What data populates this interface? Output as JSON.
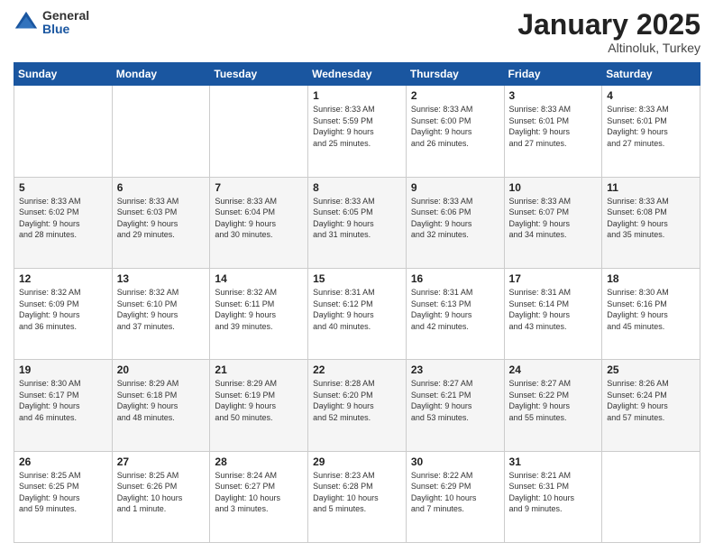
{
  "header": {
    "logo_general": "General",
    "logo_blue": "Blue",
    "month": "January 2025",
    "location": "Altinoluk, Turkey"
  },
  "weekdays": [
    "Sunday",
    "Monday",
    "Tuesday",
    "Wednesday",
    "Thursday",
    "Friday",
    "Saturday"
  ],
  "weeks": [
    [
      {
        "day": "",
        "info": ""
      },
      {
        "day": "",
        "info": ""
      },
      {
        "day": "",
        "info": ""
      },
      {
        "day": "1",
        "info": "Sunrise: 8:33 AM\nSunset: 5:59 PM\nDaylight: 9 hours\nand 25 minutes."
      },
      {
        "day": "2",
        "info": "Sunrise: 8:33 AM\nSunset: 6:00 PM\nDaylight: 9 hours\nand 26 minutes."
      },
      {
        "day": "3",
        "info": "Sunrise: 8:33 AM\nSunset: 6:01 PM\nDaylight: 9 hours\nand 27 minutes."
      },
      {
        "day": "4",
        "info": "Sunrise: 8:33 AM\nSunset: 6:01 PM\nDaylight: 9 hours\nand 27 minutes."
      }
    ],
    [
      {
        "day": "5",
        "info": "Sunrise: 8:33 AM\nSunset: 6:02 PM\nDaylight: 9 hours\nand 28 minutes."
      },
      {
        "day": "6",
        "info": "Sunrise: 8:33 AM\nSunset: 6:03 PM\nDaylight: 9 hours\nand 29 minutes."
      },
      {
        "day": "7",
        "info": "Sunrise: 8:33 AM\nSunset: 6:04 PM\nDaylight: 9 hours\nand 30 minutes."
      },
      {
        "day": "8",
        "info": "Sunrise: 8:33 AM\nSunset: 6:05 PM\nDaylight: 9 hours\nand 31 minutes."
      },
      {
        "day": "9",
        "info": "Sunrise: 8:33 AM\nSunset: 6:06 PM\nDaylight: 9 hours\nand 32 minutes."
      },
      {
        "day": "10",
        "info": "Sunrise: 8:33 AM\nSunset: 6:07 PM\nDaylight: 9 hours\nand 34 minutes."
      },
      {
        "day": "11",
        "info": "Sunrise: 8:33 AM\nSunset: 6:08 PM\nDaylight: 9 hours\nand 35 minutes."
      }
    ],
    [
      {
        "day": "12",
        "info": "Sunrise: 8:32 AM\nSunset: 6:09 PM\nDaylight: 9 hours\nand 36 minutes."
      },
      {
        "day": "13",
        "info": "Sunrise: 8:32 AM\nSunset: 6:10 PM\nDaylight: 9 hours\nand 37 minutes."
      },
      {
        "day": "14",
        "info": "Sunrise: 8:32 AM\nSunset: 6:11 PM\nDaylight: 9 hours\nand 39 minutes."
      },
      {
        "day": "15",
        "info": "Sunrise: 8:31 AM\nSunset: 6:12 PM\nDaylight: 9 hours\nand 40 minutes."
      },
      {
        "day": "16",
        "info": "Sunrise: 8:31 AM\nSunset: 6:13 PM\nDaylight: 9 hours\nand 42 minutes."
      },
      {
        "day": "17",
        "info": "Sunrise: 8:31 AM\nSunset: 6:14 PM\nDaylight: 9 hours\nand 43 minutes."
      },
      {
        "day": "18",
        "info": "Sunrise: 8:30 AM\nSunset: 6:16 PM\nDaylight: 9 hours\nand 45 minutes."
      }
    ],
    [
      {
        "day": "19",
        "info": "Sunrise: 8:30 AM\nSunset: 6:17 PM\nDaylight: 9 hours\nand 46 minutes."
      },
      {
        "day": "20",
        "info": "Sunrise: 8:29 AM\nSunset: 6:18 PM\nDaylight: 9 hours\nand 48 minutes."
      },
      {
        "day": "21",
        "info": "Sunrise: 8:29 AM\nSunset: 6:19 PM\nDaylight: 9 hours\nand 50 minutes."
      },
      {
        "day": "22",
        "info": "Sunrise: 8:28 AM\nSunset: 6:20 PM\nDaylight: 9 hours\nand 52 minutes."
      },
      {
        "day": "23",
        "info": "Sunrise: 8:27 AM\nSunset: 6:21 PM\nDaylight: 9 hours\nand 53 minutes."
      },
      {
        "day": "24",
        "info": "Sunrise: 8:27 AM\nSunset: 6:22 PM\nDaylight: 9 hours\nand 55 minutes."
      },
      {
        "day": "25",
        "info": "Sunrise: 8:26 AM\nSunset: 6:24 PM\nDaylight: 9 hours\nand 57 minutes."
      }
    ],
    [
      {
        "day": "26",
        "info": "Sunrise: 8:25 AM\nSunset: 6:25 PM\nDaylight: 9 hours\nand 59 minutes."
      },
      {
        "day": "27",
        "info": "Sunrise: 8:25 AM\nSunset: 6:26 PM\nDaylight: 10 hours\nand 1 minute."
      },
      {
        "day": "28",
        "info": "Sunrise: 8:24 AM\nSunset: 6:27 PM\nDaylight: 10 hours\nand 3 minutes."
      },
      {
        "day": "29",
        "info": "Sunrise: 8:23 AM\nSunset: 6:28 PM\nDaylight: 10 hours\nand 5 minutes."
      },
      {
        "day": "30",
        "info": "Sunrise: 8:22 AM\nSunset: 6:29 PM\nDaylight: 10 hours\nand 7 minutes."
      },
      {
        "day": "31",
        "info": "Sunrise: 8:21 AM\nSunset: 6:31 PM\nDaylight: 10 hours\nand 9 minutes."
      },
      {
        "day": "",
        "info": ""
      }
    ]
  ]
}
